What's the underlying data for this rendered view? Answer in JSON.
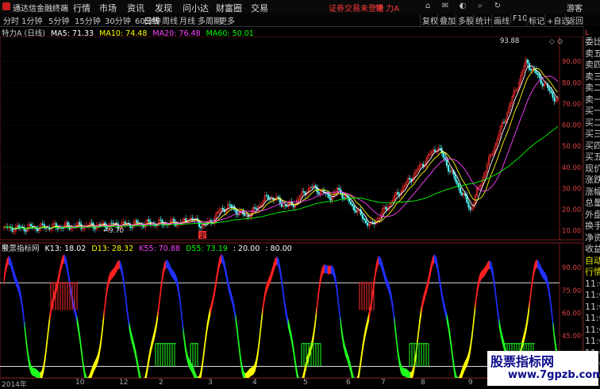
{
  "app": {
    "name": "通达信金融终端",
    "menus": [
      "行情",
      "市场",
      "资讯",
      "发现",
      "问小达",
      "财富圈",
      "交易"
    ],
    "login_warning": "证券交易未登录",
    "stock_title": "特 力A",
    "guest": "游客"
  },
  "toolbar": {
    "timeframes": [
      "分时",
      "1分钟",
      "5分钟",
      "15分钟",
      "30分钟",
      "60分钟",
      "日线",
      "周线",
      "月线",
      "多周期",
      "更多"
    ],
    "active_timeframe": "日线",
    "tools": [
      "复权",
      "叠加",
      "多股",
      "统计",
      "画线",
      "F10",
      "标记",
      "+自选",
      "返回"
    ]
  },
  "main_chart": {
    "stock_label": "特力A (日线)",
    "ma": [
      {
        "label": "MA5: 71.33",
        "color": "#ffffff"
      },
      {
        "label": "MA10: 74.48",
        "color": "#ffff00"
      },
      {
        "label": "MA20: 76.48",
        "color": "#ff40ff"
      },
      {
        "label": "MA60: 50.01",
        "color": "#00ff00"
      }
    ],
    "high_label": "93.88",
    "low_label": "9.70",
    "marker": "定",
    "y_ticks": [
      "90.00",
      "80.00",
      "70.00",
      "60.00",
      "50.00",
      "40.00",
      "30.00",
      "20.00",
      "10.00"
    ]
  },
  "indicator": {
    "name": "股票指标网",
    "values": [
      {
        "label": "K13: 18.02",
        "color": "#ffffff"
      },
      {
        "label": "D13: 28.32",
        "color": "#ffff00"
      },
      {
        "label": "K55: 70.88",
        "color": "#ff40ff"
      },
      {
        "label": "D55: 73.19",
        "color": "#00ff00"
      },
      {
        "label": ": 20.00",
        "color": "#ffffff"
      },
      {
        "label": ": 80.00",
        "color": "#ffffff"
      }
    ],
    "y_ticks": [
      "90.00",
      "75.00",
      "60.00",
      "45.00",
      "30.00"
    ]
  },
  "x_axis": [
    "2014年",
    "10",
    "12",
    "2",
    "3",
    "4",
    "5",
    "6",
    "7",
    "8",
    "9",
    "10",
    "11"
  ],
  "right_panel": {
    "header": "L",
    "items": [
      "委比",
      "卖五",
      "卖四",
      "卖三",
      "卖二",
      "卖一",
      "买一",
      "买二",
      "买三",
      "买四",
      "买五",
      "现价",
      "涨跌",
      "涨幅",
      "总量",
      "外盘",
      "换手",
      "净资",
      "收益",
      "自动",
      "行情",
      "11:08",
      "11:08",
      "11:08",
      "11:09",
      "11:09",
      "11:09",
      "11:09",
      "11:09",
      "11:09"
    ]
  },
  "watermark": {
    "line1": "股票指标网",
    "line2": "www.7gpzb.com"
  },
  "chart_data": {
    "type": "line",
    "title": "特力A (日线)",
    "ylim": [
      8,
      100
    ],
    "series": [
      {
        "name": "MA5",
        "values": [
          12,
          11,
          10,
          11,
          12,
          13,
          15,
          17,
          20,
          25,
          28,
          27,
          20,
          14,
          18,
          22,
          28,
          35,
          50,
          38,
          25,
          22,
          30,
          40,
          60,
          85,
          72,
          71
        ]
      },
      {
        "name": "MA60",
        "values": [
          11,
          11,
          11,
          11,
          11,
          12,
          12,
          13,
          14,
          16,
          18,
          20,
          21,
          21,
          22,
          23,
          24,
          26,
          30,
          32,
          32,
          31,
          32,
          35,
          40,
          45,
          48,
          50
        ]
      }
    ]
  }
}
